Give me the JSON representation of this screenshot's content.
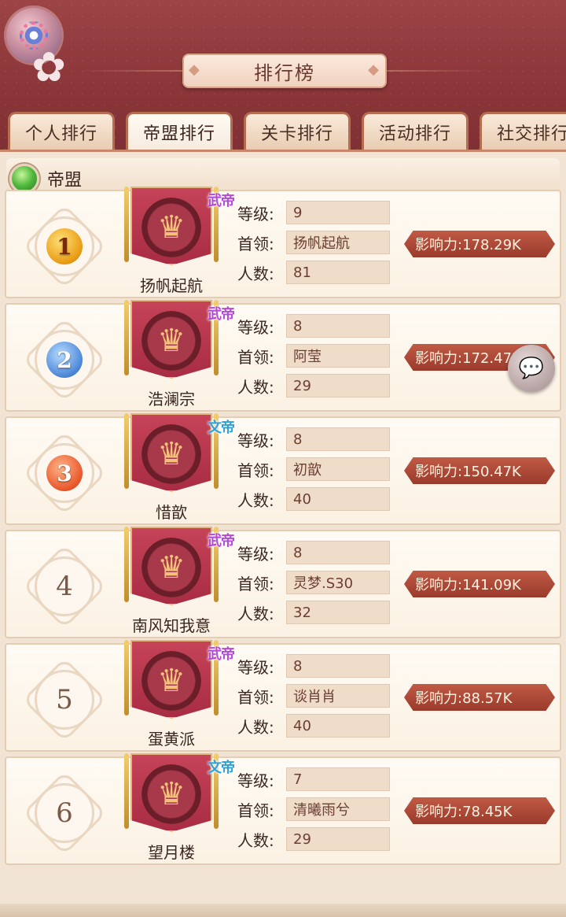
{
  "header": {
    "title": "排行榜",
    "settings_icon": "gear-icon"
  },
  "tabs": [
    {
      "label": "个人排行",
      "active": false
    },
    {
      "label": "帝盟排行",
      "active": true
    },
    {
      "label": "关卡排行",
      "active": false
    },
    {
      "label": "活动排行",
      "active": false
    },
    {
      "label": "社交排行",
      "active": false
    }
  ],
  "section": {
    "label": "帝盟"
  },
  "labels": {
    "level": "等级:",
    "leader": "首领:",
    "members": "人数:"
  },
  "rows": [
    {
      "rank": "1",
      "medal": "gold",
      "tag": "武帝",
      "tag_type": "wu",
      "name": "扬帆起航",
      "level": "9",
      "leader": "扬帆起航",
      "members": "81",
      "influence": "影响力:178.29K"
    },
    {
      "rank": "2",
      "medal": "silver",
      "tag": "武帝",
      "tag_type": "wu",
      "name": "浩澜宗",
      "level": "8",
      "leader": "阿莹",
      "members": "29",
      "influence": "影响力:172.47K"
    },
    {
      "rank": "3",
      "medal": "bronze",
      "tag": "文帝",
      "tag_type": "wen",
      "name": "惜歆",
      "level": "8",
      "leader": "初歆",
      "members": "40",
      "influence": "影响力:150.47K"
    },
    {
      "rank": "4",
      "medal": "plain",
      "tag": "武帝",
      "tag_type": "wu",
      "name": "南风知我意",
      "level": "8",
      "leader": "灵梦.S30",
      "members": "32",
      "influence": "影响力:141.09K"
    },
    {
      "rank": "5",
      "medal": "plain",
      "tag": "武帝",
      "tag_type": "wu",
      "name": "蛋黄派",
      "level": "8",
      "leader": "谈肖肖",
      "members": "40",
      "influence": "影响力:88.57K"
    },
    {
      "rank": "6",
      "medal": "plain",
      "tag": "文帝",
      "tag_type": "wen",
      "name": "望月楼",
      "level": "7",
      "leader": "清曦雨兮",
      "members": "29",
      "influence": "影响力:78.45K"
    }
  ],
  "chat_icon": "chat-bubble-icon"
}
